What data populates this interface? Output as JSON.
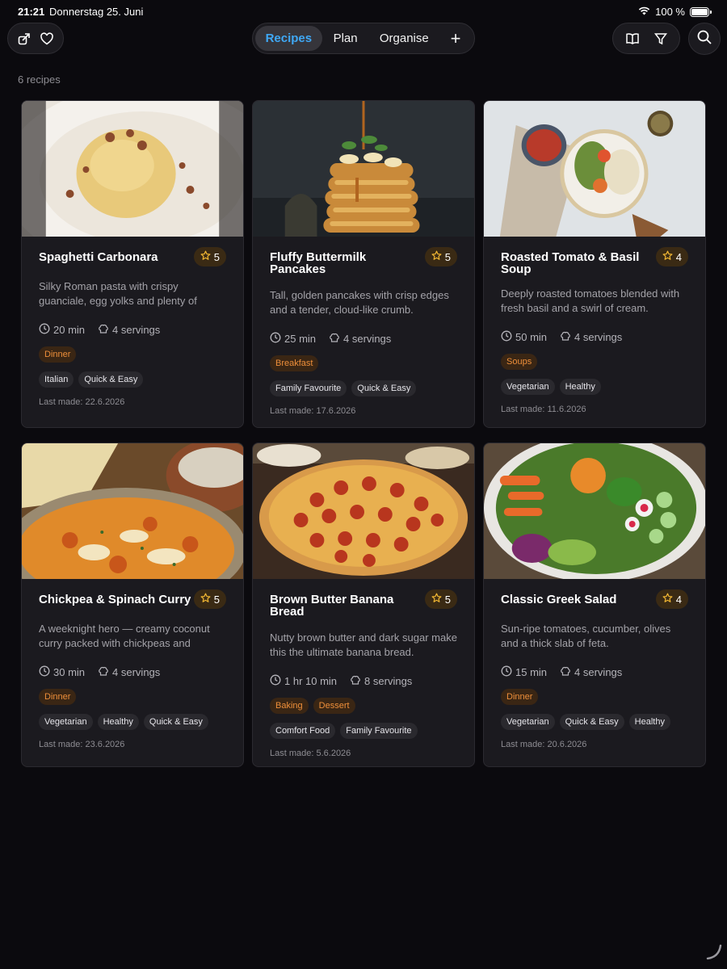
{
  "status": {
    "time": "21:21",
    "date": "Donnerstag 25. Juni",
    "battery": "100 %",
    "battery_level": 1.0
  },
  "toolbar": {
    "left_icons": [
      "share-recipe-icon",
      "heart-icon"
    ],
    "tabs": [
      {
        "label": "Recipes",
        "active": true
      },
      {
        "label": "Plan",
        "active": false
      },
      {
        "label": "Organise",
        "active": false
      }
    ],
    "add_label": "+",
    "right_icons": [
      "book-icon",
      "filter-icon"
    ],
    "search_icon": "search-icon"
  },
  "colors": {
    "background": "#0b0a0e",
    "card": "#1b1a1f",
    "accent_blue": "#3fa8f5",
    "category_orange": "#ee8f3a",
    "rating_bg": "#3a2a14"
  },
  "recipe_count": "6 recipes",
  "recipes": [
    {
      "title": "Spaghetti Carbonara",
      "rating": "5",
      "description": "Silky Roman pasta with crispy guanciale, egg yolks and plenty of pecorino — rea…",
      "time": "20 min",
      "servings": "4 servings",
      "categories": [
        "Dinner"
      ],
      "tags": [
        "Italian",
        "Quick & Easy"
      ],
      "last_made": "Last made: 22.6.2026"
    },
    {
      "title": "Fluffy Buttermilk Pancakes",
      "rating": "5",
      "description": "Tall, golden pancakes with crisp edges and a tender, cloud-like crumb.",
      "time": "25 min",
      "servings": "4 servings",
      "categories": [
        "Breakfast"
      ],
      "tags": [
        "Family Favourite",
        "Quick & Easy"
      ],
      "last_made": "Last made: 17.6.2026"
    },
    {
      "title": "Roasted Tomato & Basil Soup",
      "rating": "4",
      "description": "Deeply roasted tomatoes blended with fresh basil and a swirl of cream.",
      "time": "50 min",
      "servings": "4 servings",
      "categories": [
        "Soups"
      ],
      "tags": [
        "Vegetarian",
        "Healthy"
      ],
      "last_made": "Last made: 11.6.2026"
    },
    {
      "title": "Chickpea & Spinach Curry",
      "rating": "5",
      "description": "A weeknight hero — creamy coconut curry packed with chickpeas and greens.",
      "time": "30 min",
      "servings": "4 servings",
      "categories": [
        "Dinner"
      ],
      "tags": [
        "Vegetarian",
        "Healthy",
        "Quick & Easy"
      ],
      "last_made": "Last made: 23.6.2026"
    },
    {
      "title": "Brown Butter Banana Bread",
      "rating": "5",
      "description": "Nutty brown butter and dark sugar make this the ultimate banana bread.",
      "time": "1 hr 10 min",
      "servings": "8 servings",
      "categories": [
        "Baking",
        "Dessert"
      ],
      "tags": [
        "Comfort Food",
        "Family Favourite"
      ],
      "last_made": "Last made: 5.6.2026"
    },
    {
      "title": "Classic Greek Salad",
      "rating": "4",
      "description": "Sun-ripe tomatoes, cucumber, olives and a thick slab of feta.",
      "time": "15 min",
      "servings": "4 servings",
      "categories": [
        "Dinner"
      ],
      "tags": [
        "Vegetarian",
        "Quick & Easy",
        "Healthy"
      ],
      "last_made": "Last made: 20.6.2026"
    }
  ]
}
